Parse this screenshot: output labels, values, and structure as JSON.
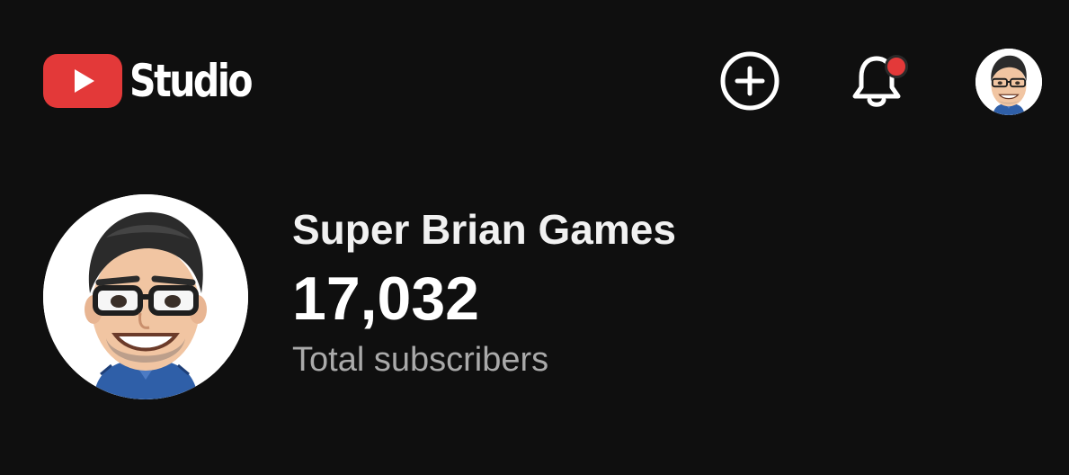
{
  "app": {
    "logo_text": "Studio"
  },
  "header": {
    "create_icon": "plus-circle-icon",
    "notifications_icon": "bell-icon",
    "has_unread_notifications": true,
    "account_icon": "avatar"
  },
  "channel": {
    "name": "Super Brian Games",
    "subscriber_count": "17,032",
    "subscriber_label": "Total subscribers"
  },
  "colors": {
    "background": "#0f0f0f",
    "brand_red": "#e33939",
    "primary_text": "#ffffff",
    "secondary_text": "#aaaaaa"
  }
}
